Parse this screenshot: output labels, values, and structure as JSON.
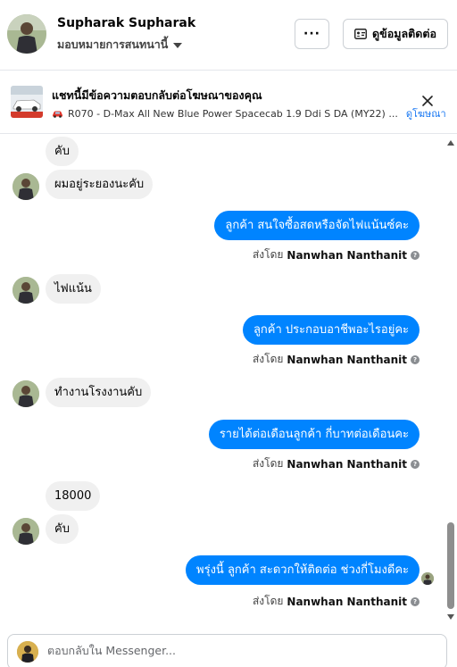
{
  "header": {
    "user_name": "Supharak Supharak",
    "assign_label": "มอบหมายการสนทนานี้",
    "more_label": "···",
    "contact_label": "ดูข้อมูลติดต่อ"
  },
  "ad_banner": {
    "title": "แชทนี้มีข้อความตอบกลับต่อโฆษณาของคุณ",
    "subtitle": "R070 - D-Max All New Blue Power Spacecab 1.9 Ddi S DA (MY22) ...",
    "link_label": "ดูโฆษณา"
  },
  "messages": {
    "m1": "คับ",
    "m2": "ผมอยู่ระยองนะคับ",
    "m3": "ลูกค้า สนใจซื้อสดหรือจัดไฟแน้นซ์คะ",
    "m4": "ไฟแน้น",
    "m5": "ลูกค้า ประกอบอาชีพอะไรอยู่คะ",
    "m6": "ทำงานโรงงานคับ",
    "m7": "รายได้ต่อเดือนลูกค้า กี่บาทต่อเดือนคะ",
    "m8": "18000",
    "m9": "คับ",
    "m10": "พรุ่งนี้ ลูกค้า สะดวกให้ติดต่อ ช่วงกี่โมงดีคะ"
  },
  "sent_by": {
    "prefix": "ส่งโดย",
    "name": "Nanwhan Nanthanit"
  },
  "reply_box": {
    "placeholder": "ตอบกลับใน Messenger..."
  },
  "colors": {
    "outgoing_bubble": "#0084ff",
    "incoming_bubble": "#f0f0f0",
    "link": "#1877f2"
  }
}
